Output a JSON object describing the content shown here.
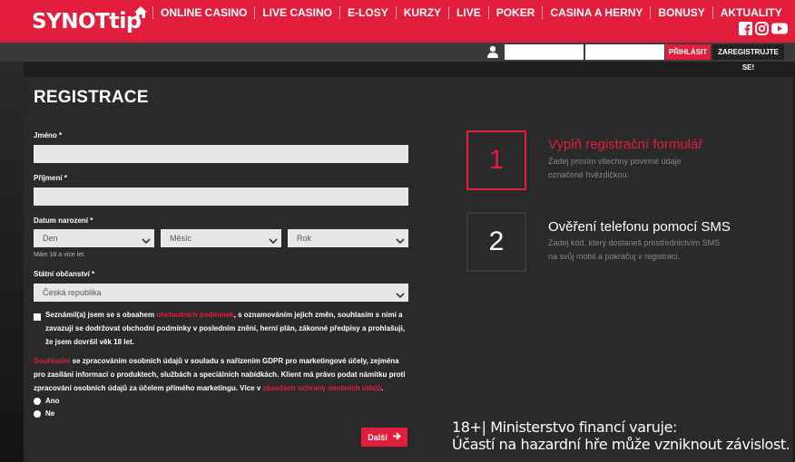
{
  "header": {
    "logo": {
      "main": "SYNOT",
      "suffix": "tip"
    },
    "nav": [
      "ONLINE CASINO",
      "LIVE CASINO",
      "E-LOSY",
      "KURZY",
      "LIVE",
      "POKER",
      "CASINA A HERNY",
      "BONUSY",
      "AKTUALITY"
    ],
    "social_icons": [
      "facebook-icon",
      "instagram-icon",
      "youtube-icon"
    ]
  },
  "login_bar": {
    "username_value": "",
    "password_value": "",
    "login_label": "PŘIHLÁSIT",
    "register_label": "ZAREGISTRUJTE SE!"
  },
  "form": {
    "title": "REGISTRACE",
    "first_name_label": "Jméno *",
    "last_name_label": "Příjmení *",
    "birthdate_label": "Datum narození *",
    "day_placeholder": "Den",
    "month_placeholder": "Měsíc",
    "year_placeholder": "Rok",
    "age_hint": "Mám 18 a více let.",
    "citizenship_label": "Státní občanství *",
    "citizenship_value": "Česká republika",
    "terms": {
      "part1": "Seznámil(a) jsem se s obsahem ",
      "link": "obchodních podmínek",
      "part2": ", s oznamováním jejich změn, souhlasím s nimi a zavazuji se dodržovat obchodní podmínky v posledním znění, herní plán, zákonné předpisy a prohlašuji, že jsem dovršil věk 18 let."
    },
    "gdpr": {
      "link1": "Souhlasím",
      "part1": " se zpracováním osobních údajů v souladu s nařízením GDPR pro marketingové účely, zejména pro zasílání informací o produktech, službách a speciálních nabídkách. Klient má právo podat námitku proti zpracování osobních údajů za účelem přímého marketingu. Více v ",
      "link2": "zásadách ochrany osobních údajů",
      "part2": "."
    },
    "yes_label": "Ano",
    "no_label": "Ne",
    "next_label": "Další"
  },
  "steps": [
    {
      "number": "1",
      "title": "Vyplň registrační formulář",
      "desc": "Zadej prosím všechny povinné údaje označené hvězdičkou."
    },
    {
      "number": "2",
      "title": "Ověření telefonu pomocí SMS",
      "desc": "Zadej kód, který dostaneš prostřednictvím SMS na svůj mobil a pokračuj v registraci."
    }
  ],
  "warning": {
    "line1": "18+| Ministerstvo financí varuje:",
    "line2": "Účastí na hazardní hře může vzniknout závislost."
  },
  "colors": {
    "brand_red": "#e31e3c",
    "panel": "#2a2a2a",
    "background": "#1e1e1e"
  }
}
